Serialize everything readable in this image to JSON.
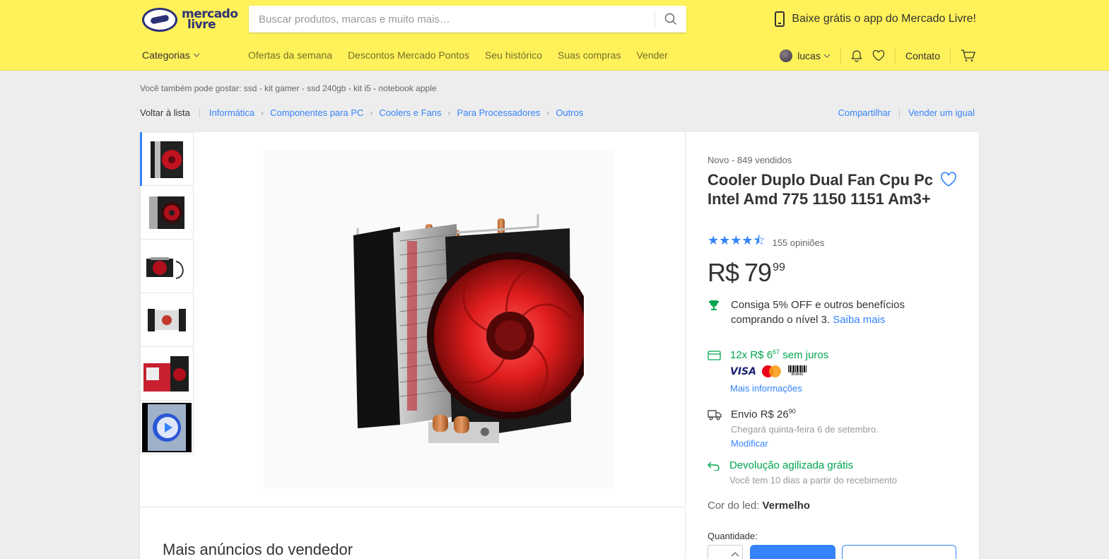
{
  "header": {
    "logo_line1": "mercado",
    "logo_line2": "livre",
    "search_placeholder": "Buscar produtos, marcas e muito mais…",
    "app_promo": "Baixe grátis o app do Mercado Livre!",
    "categories_label": "Categorias",
    "nav_links": [
      "Ofertas da semana",
      "Descontos Mercado Pontos",
      "Seu histórico",
      "Suas compras",
      "Vender"
    ],
    "user_name": "lucas",
    "contact_label": "Contato"
  },
  "also_like": "Você também pode gostar: ssd - kit gamer - ssd 240gb - kit i5 - notebook apple",
  "breadcrumb": {
    "back": "Voltar à lista",
    "items": [
      "Informática",
      "Componentes para PC",
      "Coolers e Fans",
      "Para Processadores",
      "Outros"
    ],
    "share": "Compartilhar",
    "sell_same": "Vender um igual"
  },
  "product": {
    "condition": "Novo  -  849 vendidos",
    "title": "Cooler Duplo Dual Fan Cpu Pc Intel Amd 775 1150 1151 Am3+",
    "rating": 4.5,
    "stars": "★★★★⯪",
    "reviews": "155 opiniões",
    "price_currency": "R$",
    "price_int": "79",
    "price_cents": "99",
    "loyalty_text": "Consiga 5% OFF e outros benefícios comprando o nível 3.",
    "loyalty_link": "Saiba mais",
    "installments_prefix": "12x R$ 6",
    "installments_cents": "67",
    "installments_suffix": " sem juros",
    "payment_visa": "VISA",
    "payment_boleto": "Boleto",
    "more_info": "Mais informações",
    "shipping_prefix": "Envio R$ 26",
    "shipping_cents": "90",
    "shipping_eta": "Chegará quinta-feira 6 de setembro.",
    "shipping_modify": "Modificar",
    "returns_title": "Devolução agilizada grátis",
    "returns_sub": "Você tem 10 dias a partir do recebimento",
    "color_label": "Cor do led:",
    "color_value": "Vermelho",
    "quantity_label": "Quantidade:"
  },
  "more_ads_title": "Mais anúncios do vendedor",
  "colors": {
    "header_bg": "#fff159",
    "accent_blue": "#3483fa",
    "success_green": "#00a650"
  }
}
